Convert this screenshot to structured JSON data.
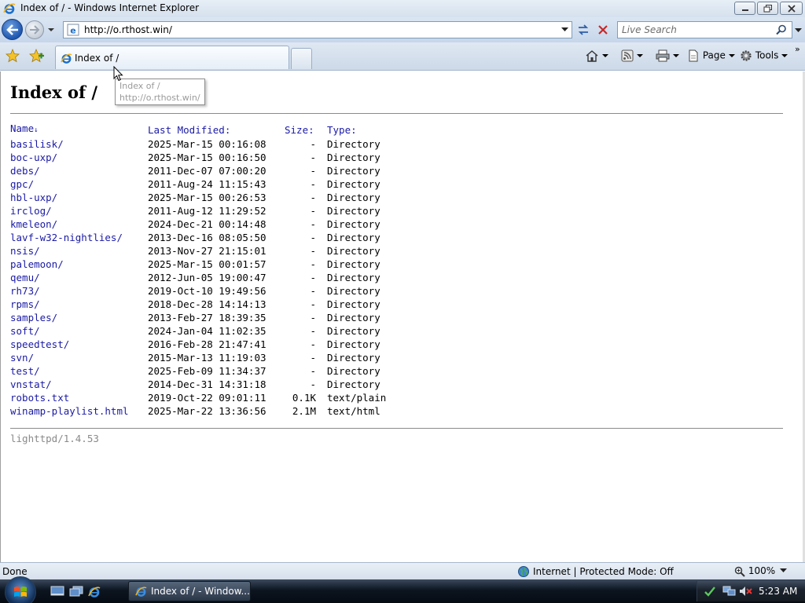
{
  "window": {
    "title": "Index of / - Windows Internet Explorer"
  },
  "address_bar": {
    "url": "http://o.rthost.win/"
  },
  "search": {
    "placeholder": "Live Search"
  },
  "tab": {
    "label": "Index of /"
  },
  "command_bar": {
    "page_label": "Page",
    "tools_label": "Tools",
    "more_label": "»"
  },
  "tooltip": {
    "line1": "Index of /",
    "line2": "http://o.rthost.win/"
  },
  "page": {
    "heading": "Index of /",
    "columns": {
      "name": "Name",
      "sort_indicator": "↓",
      "modified": "Last Modified:",
      "size": "Size:",
      "type": "Type:"
    },
    "entries": [
      {
        "name": "basilisk/",
        "modified": "2025-Mar-15 00:16:08",
        "size": "-",
        "type": "Directory"
      },
      {
        "name": "boc-uxp/",
        "modified": "2025-Mar-15 00:16:50",
        "size": "-",
        "type": "Directory"
      },
      {
        "name": "debs/",
        "modified": "2011-Dec-07 07:00:20",
        "size": "-",
        "type": "Directory"
      },
      {
        "name": "gpc/",
        "modified": "2011-Aug-24 11:15:43",
        "size": "-",
        "type": "Directory"
      },
      {
        "name": "hbl-uxp/",
        "modified": "2025-Mar-15 00:26:53",
        "size": "-",
        "type": "Directory"
      },
      {
        "name": "irclog/",
        "modified": "2011-Aug-12 11:29:52",
        "size": "-",
        "type": "Directory"
      },
      {
        "name": "kmeleon/",
        "modified": "2024-Dec-21 00:14:48",
        "size": "-",
        "type": "Directory"
      },
      {
        "name": "lavf-w32-nightlies/",
        "modified": "2013-Dec-16 08:05:50",
        "size": "-",
        "type": "Directory"
      },
      {
        "name": "nsis/",
        "modified": "2013-Nov-27 21:15:01",
        "size": "-",
        "type": "Directory"
      },
      {
        "name": "palemoon/",
        "modified": "2025-Mar-15 00:01:57",
        "size": "-",
        "type": "Directory"
      },
      {
        "name": "qemu/",
        "modified": "2012-Jun-05 19:00:47",
        "size": "-",
        "type": "Directory"
      },
      {
        "name": "rh73/",
        "modified": "2019-Oct-10 19:49:56",
        "size": "-",
        "type": "Directory"
      },
      {
        "name": "rpms/",
        "modified": "2018-Dec-28 14:14:13",
        "size": "-",
        "type": "Directory"
      },
      {
        "name": "samples/",
        "modified": "2013-Feb-27 18:39:35",
        "size": "-",
        "type": "Directory"
      },
      {
        "name": "soft/",
        "modified": "2024-Jan-04 11:02:35",
        "size": "-",
        "type": "Directory"
      },
      {
        "name": "speedtest/",
        "modified": "2016-Feb-28 21:47:41",
        "size": "-",
        "type": "Directory"
      },
      {
        "name": "svn/",
        "modified": "2015-Mar-13 11:19:03",
        "size": "-",
        "type": "Directory"
      },
      {
        "name": "test/",
        "modified": "2025-Feb-09 11:34:37",
        "size": "-",
        "type": "Directory"
      },
      {
        "name": "vnstat/",
        "modified": "2014-Dec-31 14:31:18",
        "size": "-",
        "type": "Directory"
      },
      {
        "name": "robots.txt",
        "modified": "2019-Oct-22 09:01:11",
        "size": "0.1K",
        "type": "text/plain"
      },
      {
        "name": "winamp-playlist.html",
        "modified": "2025-Mar-22 13:36:56",
        "size": "2.1M",
        "type": "text/html"
      }
    ],
    "server_signature": "lighttpd/1.4.53"
  },
  "status_bar": {
    "status": "Done",
    "zone": "Internet | Protected Mode: Off",
    "zoom": "100%"
  },
  "taskbar": {
    "task_label": "Index of / - Window...",
    "clock": "5:23 AM"
  },
  "icons": {
    "back": "back-arrow-icon",
    "forward": "forward-arrow-icon",
    "ie": "ie-logo-icon",
    "favorites": "star-icon",
    "home": "home-icon",
    "feeds": "rss-icon",
    "print": "printer-icon",
    "tools": "gear-icon"
  },
  "colors": {
    "link": "#1a1aa6",
    "footer_text": "#8a8a8a",
    "chrome_blue": "#c6d6ea"
  }
}
